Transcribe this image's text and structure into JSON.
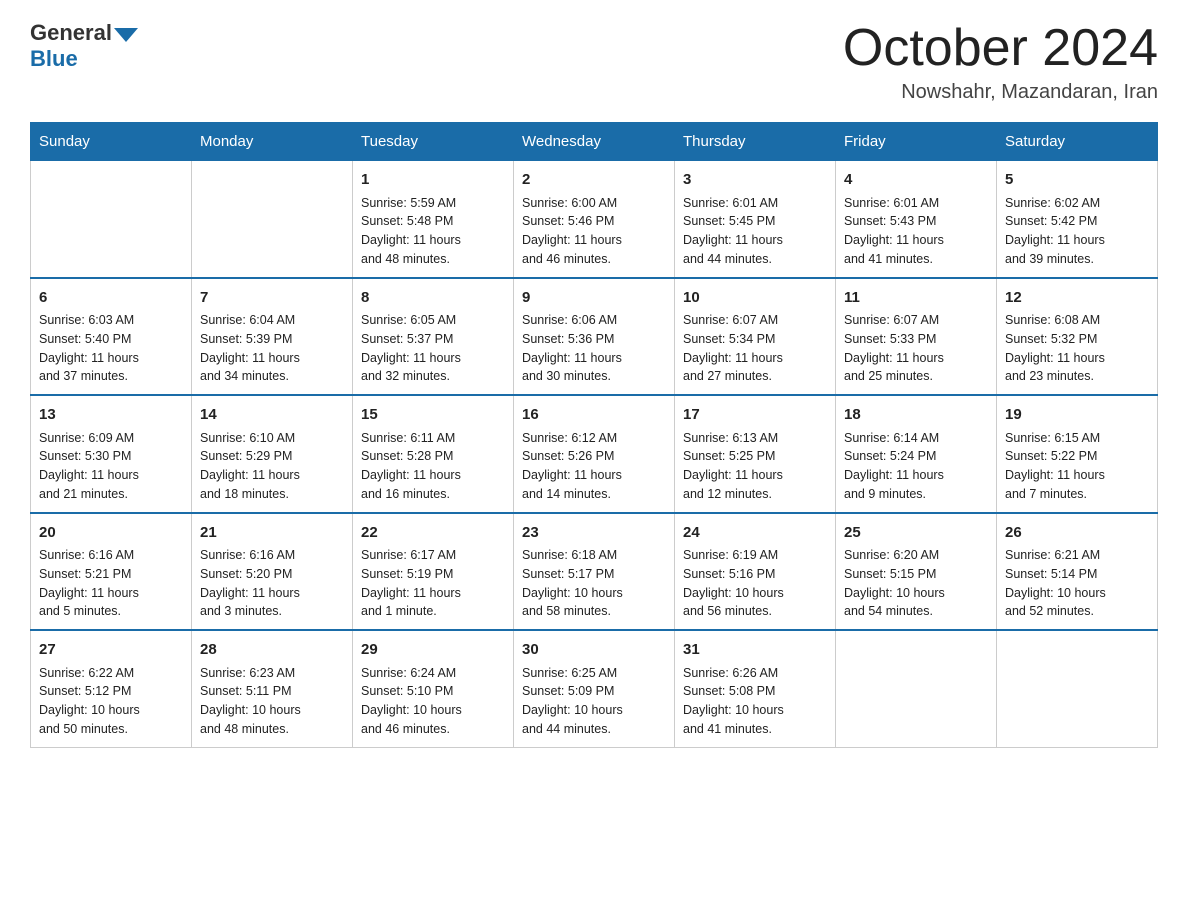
{
  "header": {
    "logo_general": "General",
    "logo_blue": "Blue",
    "month_title": "October 2024",
    "location": "Nowshahr, Mazandaran, Iran"
  },
  "weekdays": [
    "Sunday",
    "Monday",
    "Tuesday",
    "Wednesday",
    "Thursday",
    "Friday",
    "Saturday"
  ],
  "weeks": [
    [
      {
        "day": "",
        "info": ""
      },
      {
        "day": "",
        "info": ""
      },
      {
        "day": "1",
        "info": "Sunrise: 5:59 AM\nSunset: 5:48 PM\nDaylight: 11 hours\nand 48 minutes."
      },
      {
        "day": "2",
        "info": "Sunrise: 6:00 AM\nSunset: 5:46 PM\nDaylight: 11 hours\nand 46 minutes."
      },
      {
        "day": "3",
        "info": "Sunrise: 6:01 AM\nSunset: 5:45 PM\nDaylight: 11 hours\nand 44 minutes."
      },
      {
        "day": "4",
        "info": "Sunrise: 6:01 AM\nSunset: 5:43 PM\nDaylight: 11 hours\nand 41 minutes."
      },
      {
        "day": "5",
        "info": "Sunrise: 6:02 AM\nSunset: 5:42 PM\nDaylight: 11 hours\nand 39 minutes."
      }
    ],
    [
      {
        "day": "6",
        "info": "Sunrise: 6:03 AM\nSunset: 5:40 PM\nDaylight: 11 hours\nand 37 minutes."
      },
      {
        "day": "7",
        "info": "Sunrise: 6:04 AM\nSunset: 5:39 PM\nDaylight: 11 hours\nand 34 minutes."
      },
      {
        "day": "8",
        "info": "Sunrise: 6:05 AM\nSunset: 5:37 PM\nDaylight: 11 hours\nand 32 minutes."
      },
      {
        "day": "9",
        "info": "Sunrise: 6:06 AM\nSunset: 5:36 PM\nDaylight: 11 hours\nand 30 minutes."
      },
      {
        "day": "10",
        "info": "Sunrise: 6:07 AM\nSunset: 5:34 PM\nDaylight: 11 hours\nand 27 minutes."
      },
      {
        "day": "11",
        "info": "Sunrise: 6:07 AM\nSunset: 5:33 PM\nDaylight: 11 hours\nand 25 minutes."
      },
      {
        "day": "12",
        "info": "Sunrise: 6:08 AM\nSunset: 5:32 PM\nDaylight: 11 hours\nand 23 minutes."
      }
    ],
    [
      {
        "day": "13",
        "info": "Sunrise: 6:09 AM\nSunset: 5:30 PM\nDaylight: 11 hours\nand 21 minutes."
      },
      {
        "day": "14",
        "info": "Sunrise: 6:10 AM\nSunset: 5:29 PM\nDaylight: 11 hours\nand 18 minutes."
      },
      {
        "day": "15",
        "info": "Sunrise: 6:11 AM\nSunset: 5:28 PM\nDaylight: 11 hours\nand 16 minutes."
      },
      {
        "day": "16",
        "info": "Sunrise: 6:12 AM\nSunset: 5:26 PM\nDaylight: 11 hours\nand 14 minutes."
      },
      {
        "day": "17",
        "info": "Sunrise: 6:13 AM\nSunset: 5:25 PM\nDaylight: 11 hours\nand 12 minutes."
      },
      {
        "day": "18",
        "info": "Sunrise: 6:14 AM\nSunset: 5:24 PM\nDaylight: 11 hours\nand 9 minutes."
      },
      {
        "day": "19",
        "info": "Sunrise: 6:15 AM\nSunset: 5:22 PM\nDaylight: 11 hours\nand 7 minutes."
      }
    ],
    [
      {
        "day": "20",
        "info": "Sunrise: 6:16 AM\nSunset: 5:21 PM\nDaylight: 11 hours\nand 5 minutes."
      },
      {
        "day": "21",
        "info": "Sunrise: 6:16 AM\nSunset: 5:20 PM\nDaylight: 11 hours\nand 3 minutes."
      },
      {
        "day": "22",
        "info": "Sunrise: 6:17 AM\nSunset: 5:19 PM\nDaylight: 11 hours\nand 1 minute."
      },
      {
        "day": "23",
        "info": "Sunrise: 6:18 AM\nSunset: 5:17 PM\nDaylight: 10 hours\nand 58 minutes."
      },
      {
        "day": "24",
        "info": "Sunrise: 6:19 AM\nSunset: 5:16 PM\nDaylight: 10 hours\nand 56 minutes."
      },
      {
        "day": "25",
        "info": "Sunrise: 6:20 AM\nSunset: 5:15 PM\nDaylight: 10 hours\nand 54 minutes."
      },
      {
        "day": "26",
        "info": "Sunrise: 6:21 AM\nSunset: 5:14 PM\nDaylight: 10 hours\nand 52 minutes."
      }
    ],
    [
      {
        "day": "27",
        "info": "Sunrise: 6:22 AM\nSunset: 5:12 PM\nDaylight: 10 hours\nand 50 minutes."
      },
      {
        "day": "28",
        "info": "Sunrise: 6:23 AM\nSunset: 5:11 PM\nDaylight: 10 hours\nand 48 minutes."
      },
      {
        "day": "29",
        "info": "Sunrise: 6:24 AM\nSunset: 5:10 PM\nDaylight: 10 hours\nand 46 minutes."
      },
      {
        "day": "30",
        "info": "Sunrise: 6:25 AM\nSunset: 5:09 PM\nDaylight: 10 hours\nand 44 minutes."
      },
      {
        "day": "31",
        "info": "Sunrise: 6:26 AM\nSunset: 5:08 PM\nDaylight: 10 hours\nand 41 minutes."
      },
      {
        "day": "",
        "info": ""
      },
      {
        "day": "",
        "info": ""
      }
    ]
  ]
}
